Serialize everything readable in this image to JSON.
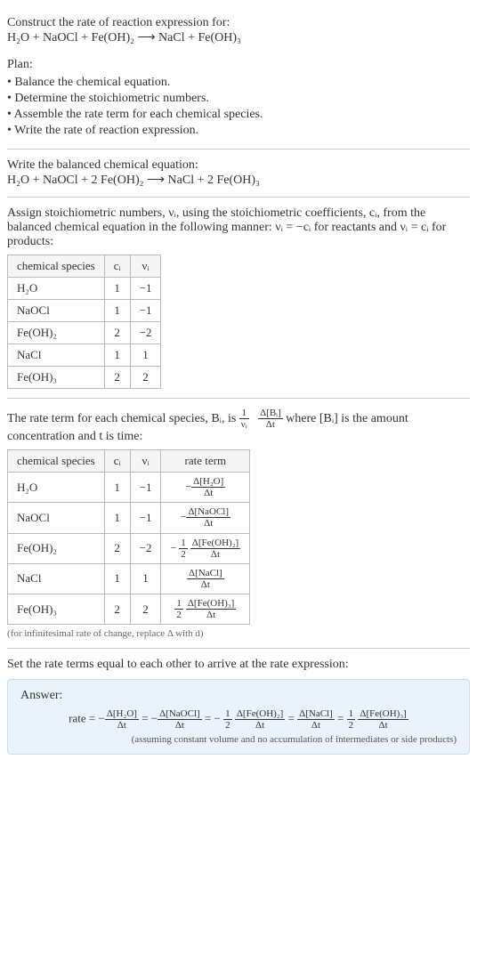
{
  "intro": {
    "title": "Construct the rate of reaction expression for:",
    "equation": "H₂O + NaOCl + Fe(OH)₂ ⟶ NaCl + Fe(OH)₃",
    "plan_label": "Plan:",
    "plan": [
      "• Balance the chemical equation.",
      "• Determine the stoichiometric numbers.",
      "• Assemble the rate term for each chemical species.",
      "• Write the rate of reaction expression."
    ]
  },
  "balanced": {
    "title": "Write the balanced chemical equation:",
    "equation": "H₂O + NaOCl + 2 Fe(OH)₂ ⟶ NaCl + 2 Fe(OH)₃"
  },
  "stoich": {
    "text": "Assign stoichiometric numbers, νᵢ, using the stoichiometric coefficients, cᵢ, from the balanced chemical equation in the following manner: νᵢ = −cᵢ for reactants and νᵢ = cᵢ for products:",
    "headers": [
      "chemical species",
      "cᵢ",
      "νᵢ"
    ],
    "rows": [
      {
        "sp": "H₂O",
        "c": "1",
        "v": "−1"
      },
      {
        "sp": "NaOCl",
        "c": "1",
        "v": "−1"
      },
      {
        "sp": "Fe(OH)₂",
        "c": "2",
        "v": "−2"
      },
      {
        "sp": "NaCl",
        "c": "1",
        "v": "1"
      },
      {
        "sp": "Fe(OH)₃",
        "c": "2",
        "v": "2"
      }
    ]
  },
  "rateterm": {
    "text_a": "The rate term for each chemical species, Bᵢ, is ",
    "text_b": " where [Bᵢ] is the amount concentration and t is time:",
    "headers": [
      "chemical species",
      "cᵢ",
      "νᵢ",
      "rate term"
    ],
    "rows": [
      {
        "sp": "H₂O",
        "c": "1",
        "v": "−1",
        "pre": "−",
        "coef": "",
        "d": "Δ[H₂O]"
      },
      {
        "sp": "NaOCl",
        "c": "1",
        "v": "−1",
        "pre": "−",
        "coef": "",
        "d": "Δ[NaOCl]"
      },
      {
        "sp": "Fe(OH)₂",
        "c": "2",
        "v": "−2",
        "pre": "−",
        "coef": "½",
        "d": "Δ[Fe(OH)₂]"
      },
      {
        "sp": "NaCl",
        "c": "1",
        "v": "1",
        "pre": "",
        "coef": "",
        "d": "Δ[NaCl]"
      },
      {
        "sp": "Fe(OH)₃",
        "c": "2",
        "v": "2",
        "pre": "",
        "coef": "½",
        "d": "Δ[Fe(OH)₃]"
      }
    ],
    "note": "(for infinitesimal rate of change, replace Δ with d)"
  },
  "final": {
    "title": "Set the rate terms equal to each other to arrive at the rate expression:",
    "answer_label": "Answer:",
    "prefix": "rate = ",
    "terms": [
      {
        "pre": "−",
        "coef": "",
        "d": "Δ[H₂O]"
      },
      {
        "pre": "−",
        "coef": "",
        "d": "Δ[NaOCl]"
      },
      {
        "pre": "−",
        "coef": "½",
        "d": "Δ[Fe(OH)₂]"
      },
      {
        "pre": "",
        "coef": "",
        "d": "Δ[NaCl]"
      },
      {
        "pre": "",
        "coef": "½",
        "d": "Δ[Fe(OH)₃]"
      }
    ],
    "assume": "(assuming constant volume and no accumulation of intermediates or side products)"
  },
  "dt": "Δt",
  "one_over_nu": {
    "num": "1",
    "den": "νᵢ"
  },
  "dBi": {
    "num": "Δ[Bᵢ]",
    "den": "Δt"
  }
}
